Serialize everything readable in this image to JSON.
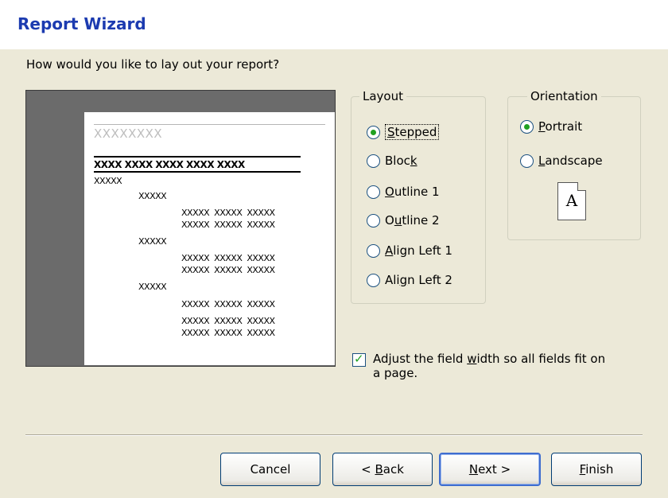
{
  "window": {
    "title": "Report Wizard"
  },
  "prompt": "How would you like to lay out your report?",
  "preview": {
    "title_placeholder": "XXXXXXXX",
    "header_row": "XXXX  XXXX  XXXX  XXXX  XXXX",
    "group1": "XXXXX",
    "group2": "XXXXX",
    "detail": "XXXXX  XXXXX  XXXXX"
  },
  "layout": {
    "legend": "Layout",
    "options": [
      {
        "pre": "",
        "key": "S",
        "post": "tepped",
        "selected": true
      },
      {
        "pre": "Bloc",
        "key": "k",
        "post": "",
        "selected": false
      },
      {
        "pre": "",
        "key": "O",
        "post": "utline 1",
        "selected": false
      },
      {
        "pre": "O",
        "key": "u",
        "post": "tline 2",
        "selected": false
      },
      {
        "pre": "",
        "key": "A",
        "post": "lign Left 1",
        "selected": false
      },
      {
        "pre": "Ali",
        "key": "g",
        "post": "n Left 2",
        "selected": false
      }
    ]
  },
  "orientation": {
    "legend": "Orientation",
    "options": [
      {
        "pre": "",
        "key": "P",
        "post": "ortrait",
        "selected": true
      },
      {
        "pre": "",
        "key": "L",
        "post": "andscape",
        "selected": false
      }
    ],
    "icon_letter": "A"
  },
  "adjust_width": {
    "line1_pre": "Adjust the field ",
    "line1_key": "w",
    "line1_post": "idth so all fields fit on",
    "line2": "a page.",
    "checked": true
  },
  "buttons": {
    "cancel": "Cancel",
    "back_pre": "< ",
    "back_key": "B",
    "back_post": "ack",
    "next_key": "N",
    "next_post": "ext >",
    "finish_key": "F",
    "finish_post": "inish"
  }
}
